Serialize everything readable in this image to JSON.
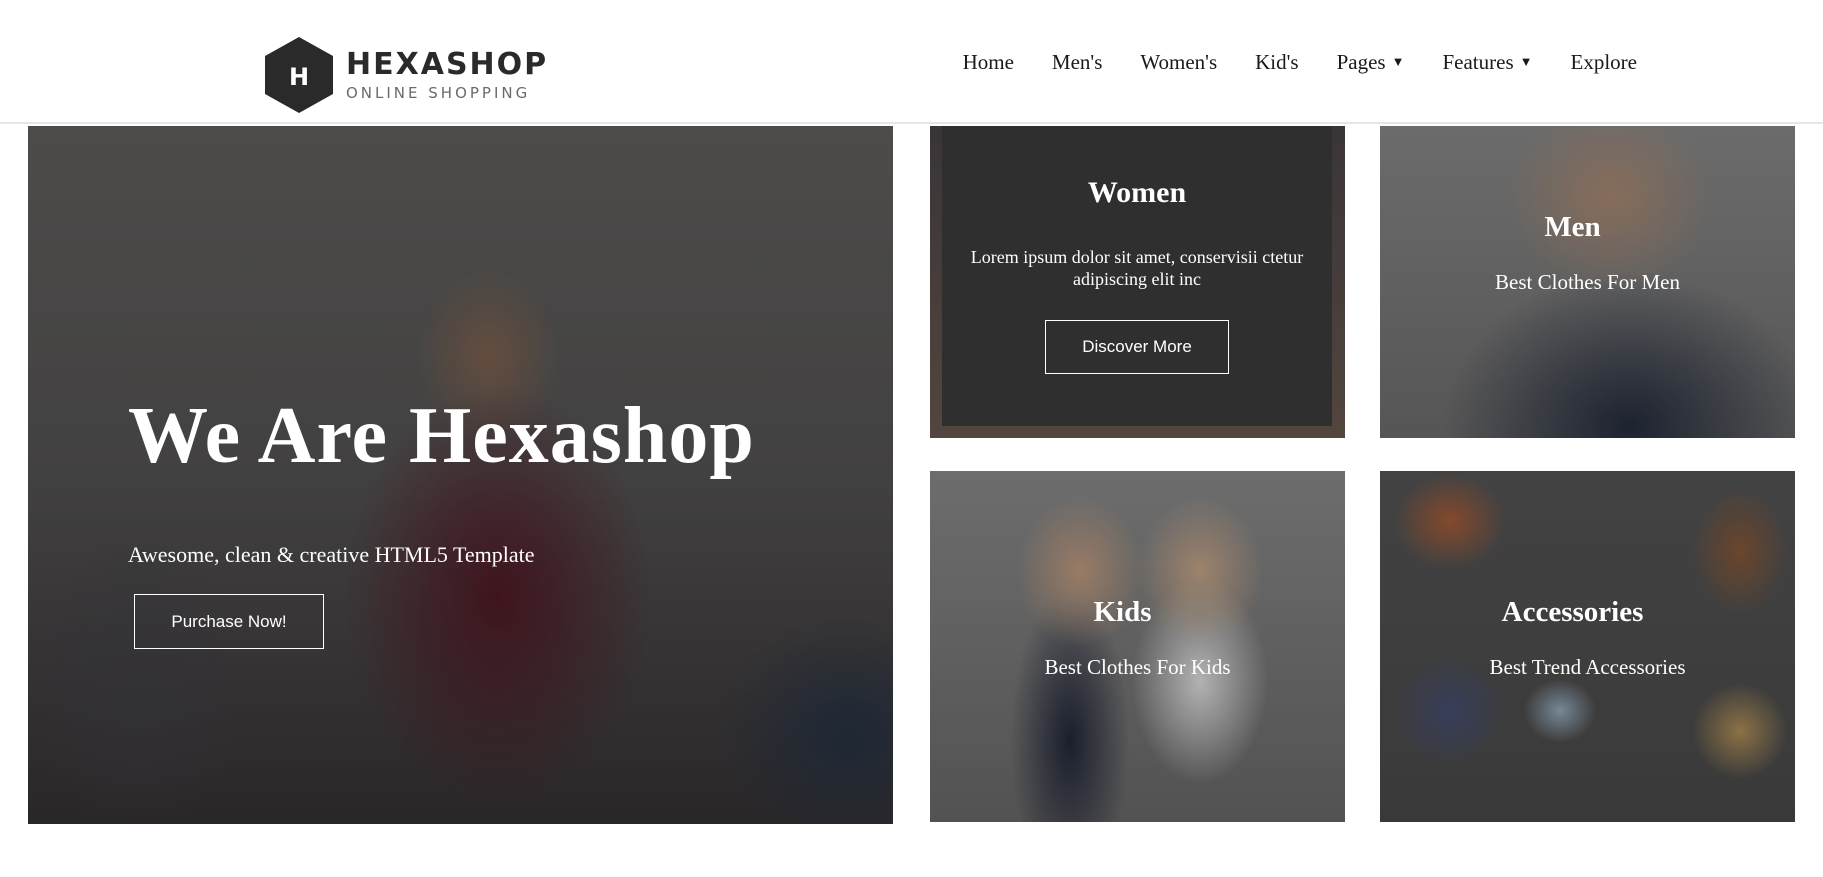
{
  "header": {
    "logo_letter": "H",
    "logo_title": "HEXASHOP",
    "logo_subtitle": "ONLINE SHOPPING",
    "nav": [
      {
        "label": "Home"
      },
      {
        "label": "Men's"
      },
      {
        "label": "Women's"
      },
      {
        "label": "Kid's"
      },
      {
        "label": "Pages",
        "dropdown": true
      },
      {
        "label": "Features",
        "dropdown": true
      },
      {
        "label": "Explore"
      }
    ]
  },
  "hero": {
    "title": "We Are Hexashop",
    "subtitle": "Awesome, clean & creative HTML5 Template",
    "button": "Purchase Now!"
  },
  "cards": {
    "women": {
      "title": "Women",
      "description": "Lorem ipsum dolor sit amet, conservisii ctetur adipiscing elit inc",
      "button": "Discover More"
    },
    "men": {
      "title": "Men",
      "subtitle": "Best Clothes For Men"
    },
    "kids": {
      "title": "Kids",
      "subtitle": "Best Clothes For Kids"
    },
    "accessories": {
      "title": "Accessories",
      "subtitle": "Best Trend Accessories"
    }
  },
  "colors": {
    "dark": "#2a2a2a",
    "overlay": "#2f2f2f",
    "text_on_image": "#ffffff"
  },
  "icons": {
    "dropdown": "caret-down-icon",
    "logo": "hexagon-logo-icon"
  }
}
